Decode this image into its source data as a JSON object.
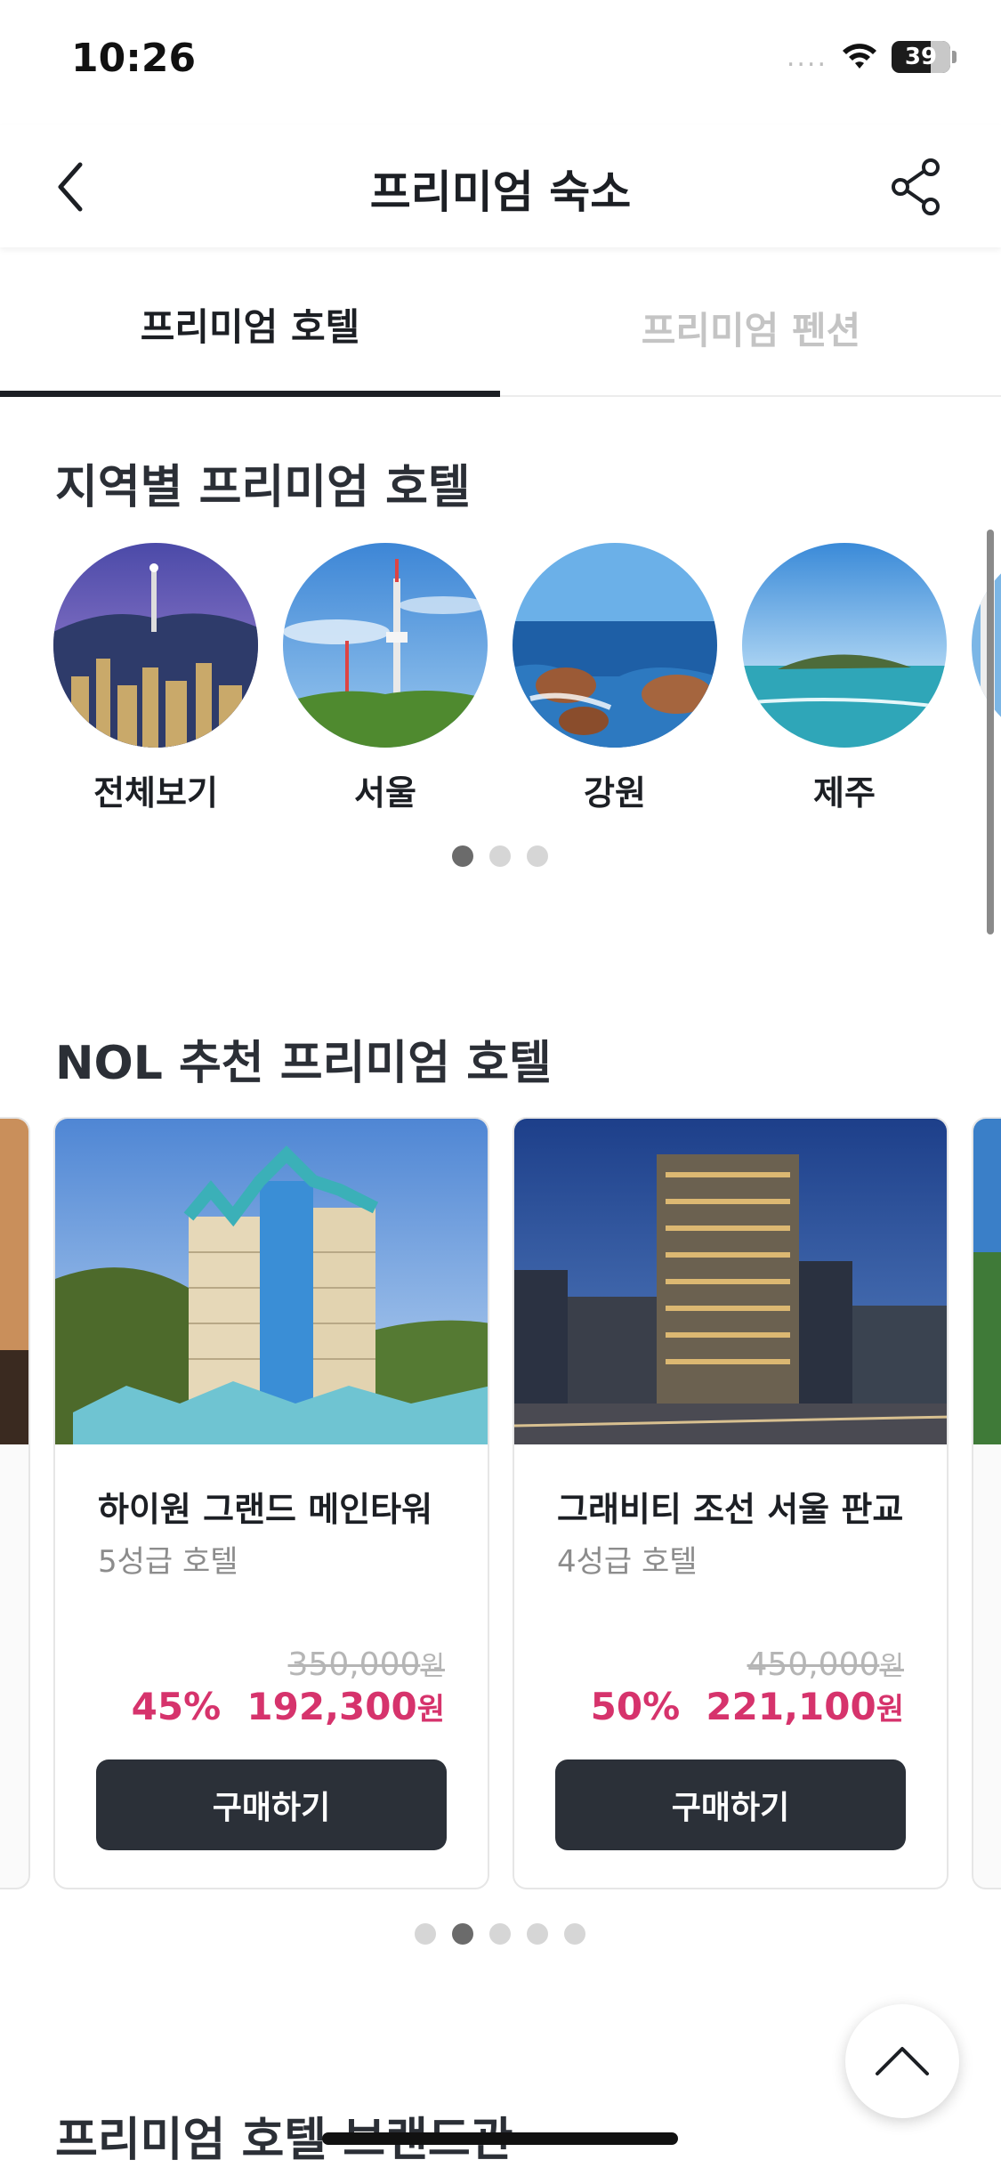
{
  "status_bar": {
    "time": "10:26",
    "signal": "....",
    "battery": "39"
  },
  "header": {
    "title": "프리미엄 숙소"
  },
  "tabs": [
    {
      "label": "프리미엄 호텔",
      "active": true
    },
    {
      "label": "프리미엄 펜션",
      "active": false
    }
  ],
  "regions_section": {
    "title": "지역별 프리미엄 호텔",
    "items": [
      {
        "label": "전체보기",
        "image": "seoul-night-tower"
      },
      {
        "label": "서울",
        "image": "namsan-tower-day"
      },
      {
        "label": "강원",
        "image": "rocky-coast"
      },
      {
        "label": "제주",
        "image": "jeju-island-sea"
      }
    ],
    "pagination": {
      "pages": 3,
      "current": 1
    }
  },
  "recommend_section": {
    "title": "NOL 추천 프리미엄 호텔",
    "cards": [
      {
        "name": "하이원 그랜드 메인타워",
        "grade": "5성급 호텔",
        "original_price": "350,000",
        "discount": "45%",
        "price": "192,300",
        "currency": "원",
        "button": "구매하기"
      },
      {
        "name": "그래비티 조선 서울 판교",
        "grade": "4성급 호텔",
        "original_price": "450,000",
        "discount": "50%",
        "price": "221,100",
        "currency": "원",
        "button": "구매하기"
      }
    ],
    "pagination": {
      "pages": 5,
      "current": 2
    }
  },
  "brand_section": {
    "title": "프리미엄 호텔 브랜드관"
  },
  "colors": {
    "accent_price": "#d6336c",
    "button_dark": "#2b3038",
    "text_dark": "#1c1f24"
  },
  "icons": {
    "back": "chevron-left-icon",
    "share": "share-icon",
    "top": "chevron-up-icon"
  }
}
